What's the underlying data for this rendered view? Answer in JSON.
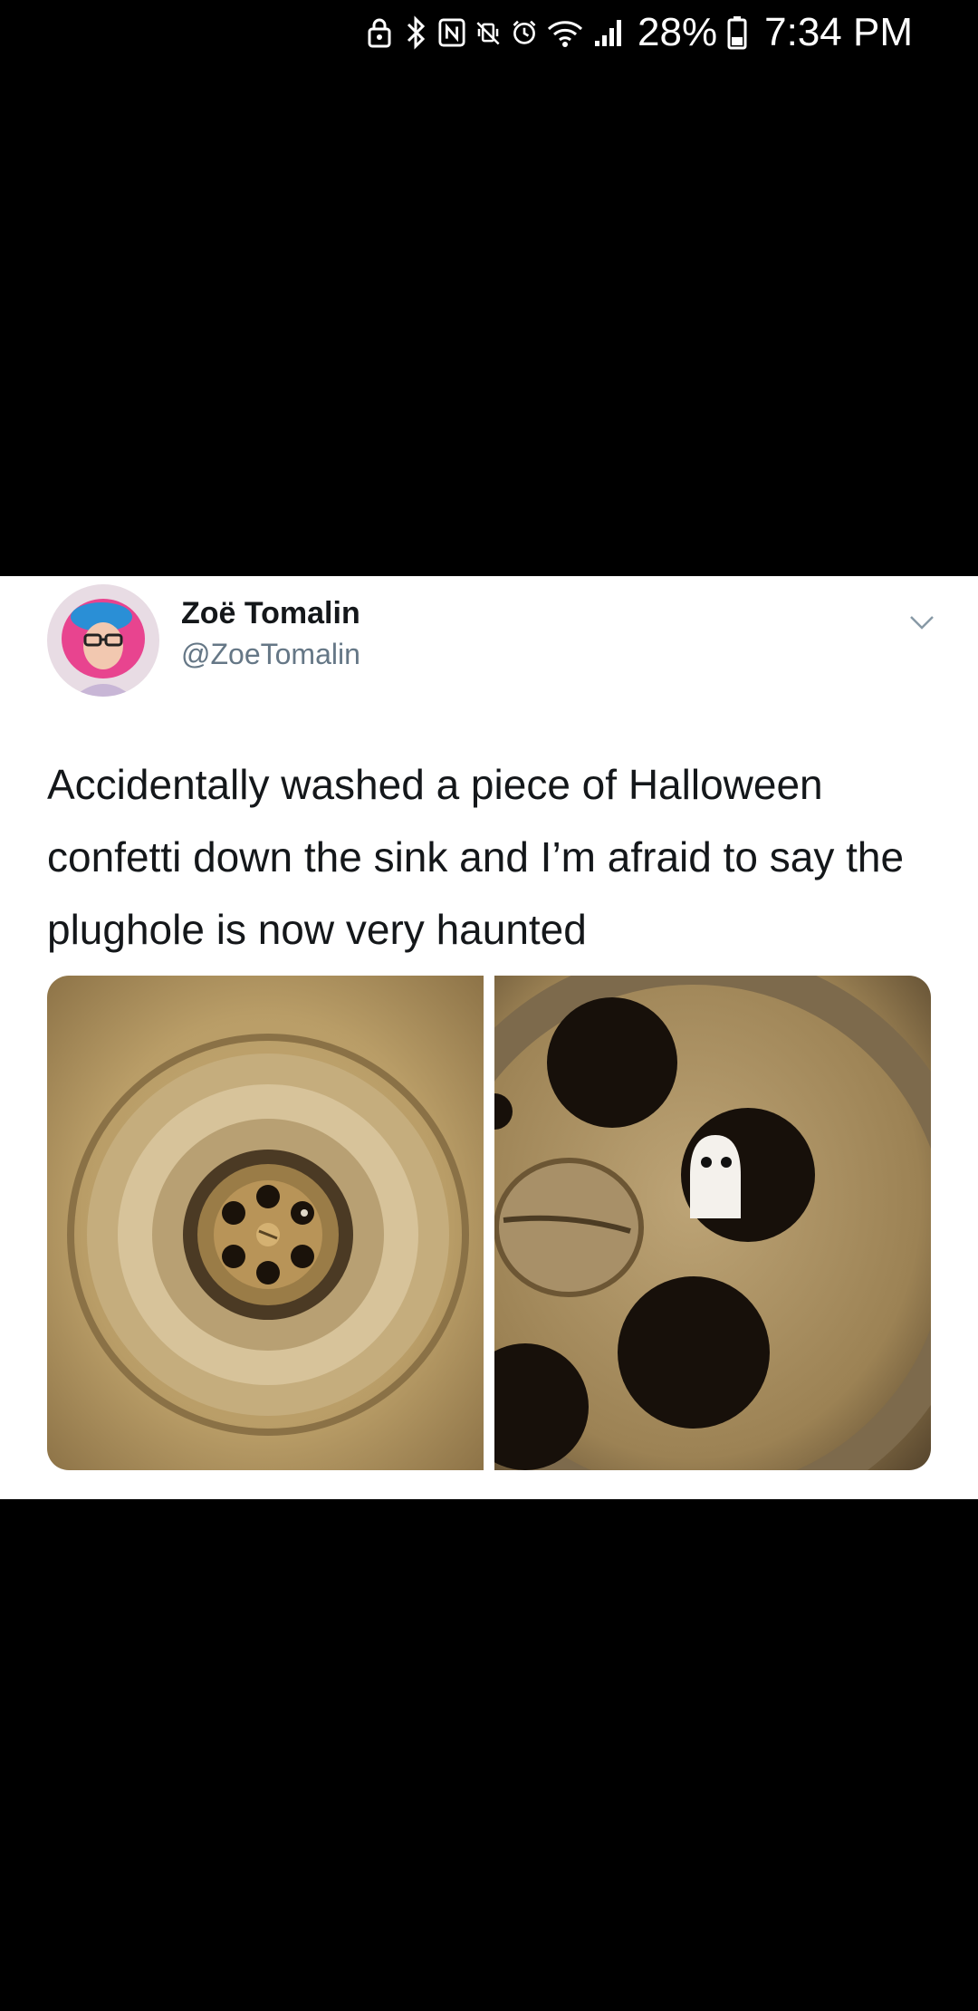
{
  "status_bar": {
    "battery_percent": "28%",
    "time": "7:34 PM",
    "icons": [
      "lock-icon",
      "bluetooth-icon",
      "nfc-icon",
      "vibrate-icon",
      "alarm-icon",
      "wifi-icon",
      "signal-icon",
      "battery-icon"
    ]
  },
  "tweet": {
    "author_name": "Zoë Tomalin",
    "author_handle": "@ZoeTomalin",
    "text": "Accidentally washed a piece of Halloween confetti down the sink and I’m afraid to say the plughole is now very haunted",
    "media": [
      {
        "name": "sink-drain-photo"
      },
      {
        "name": "plughole-ghost-photo"
      }
    ]
  },
  "colors": {
    "background": "#000000",
    "card": "#ffffff",
    "name": "#14171a",
    "handle": "#657786"
  }
}
